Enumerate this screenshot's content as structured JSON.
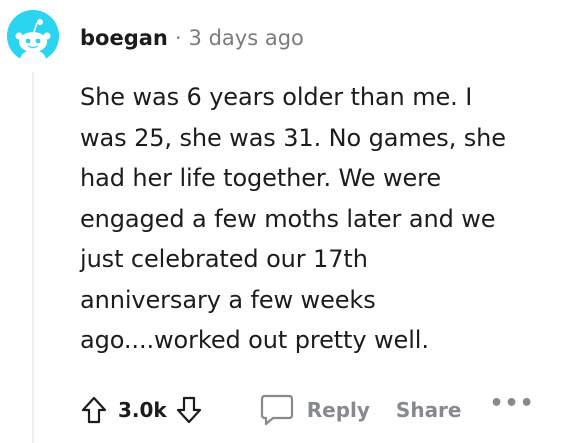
{
  "comment": {
    "author": "boegan",
    "separator": "·",
    "time": "3 days ago",
    "body_lines": [
      "She was 6 years older than me. I",
      "was 25, she was 31. No games, she",
      "had her life together. We were",
      "engaged a few moths later and we",
      "just celebrated our 17th",
      "anniversary a few weeks",
      "ago....worked out pretty well."
    ],
    "score": "3.0k",
    "reply_label": "Reply",
    "share_label": "Share",
    "more_label": "•••"
  },
  "colors": {
    "avatar_bg": "#2bd5f0",
    "text": "#1c1c1c",
    "muted": "#878a8c"
  },
  "icons": {
    "avatar": "snoo-avatar-icon",
    "upvote": "upvote-arrow-icon",
    "downvote": "downvote-arrow-icon",
    "reply": "comment-bubble-icon"
  }
}
